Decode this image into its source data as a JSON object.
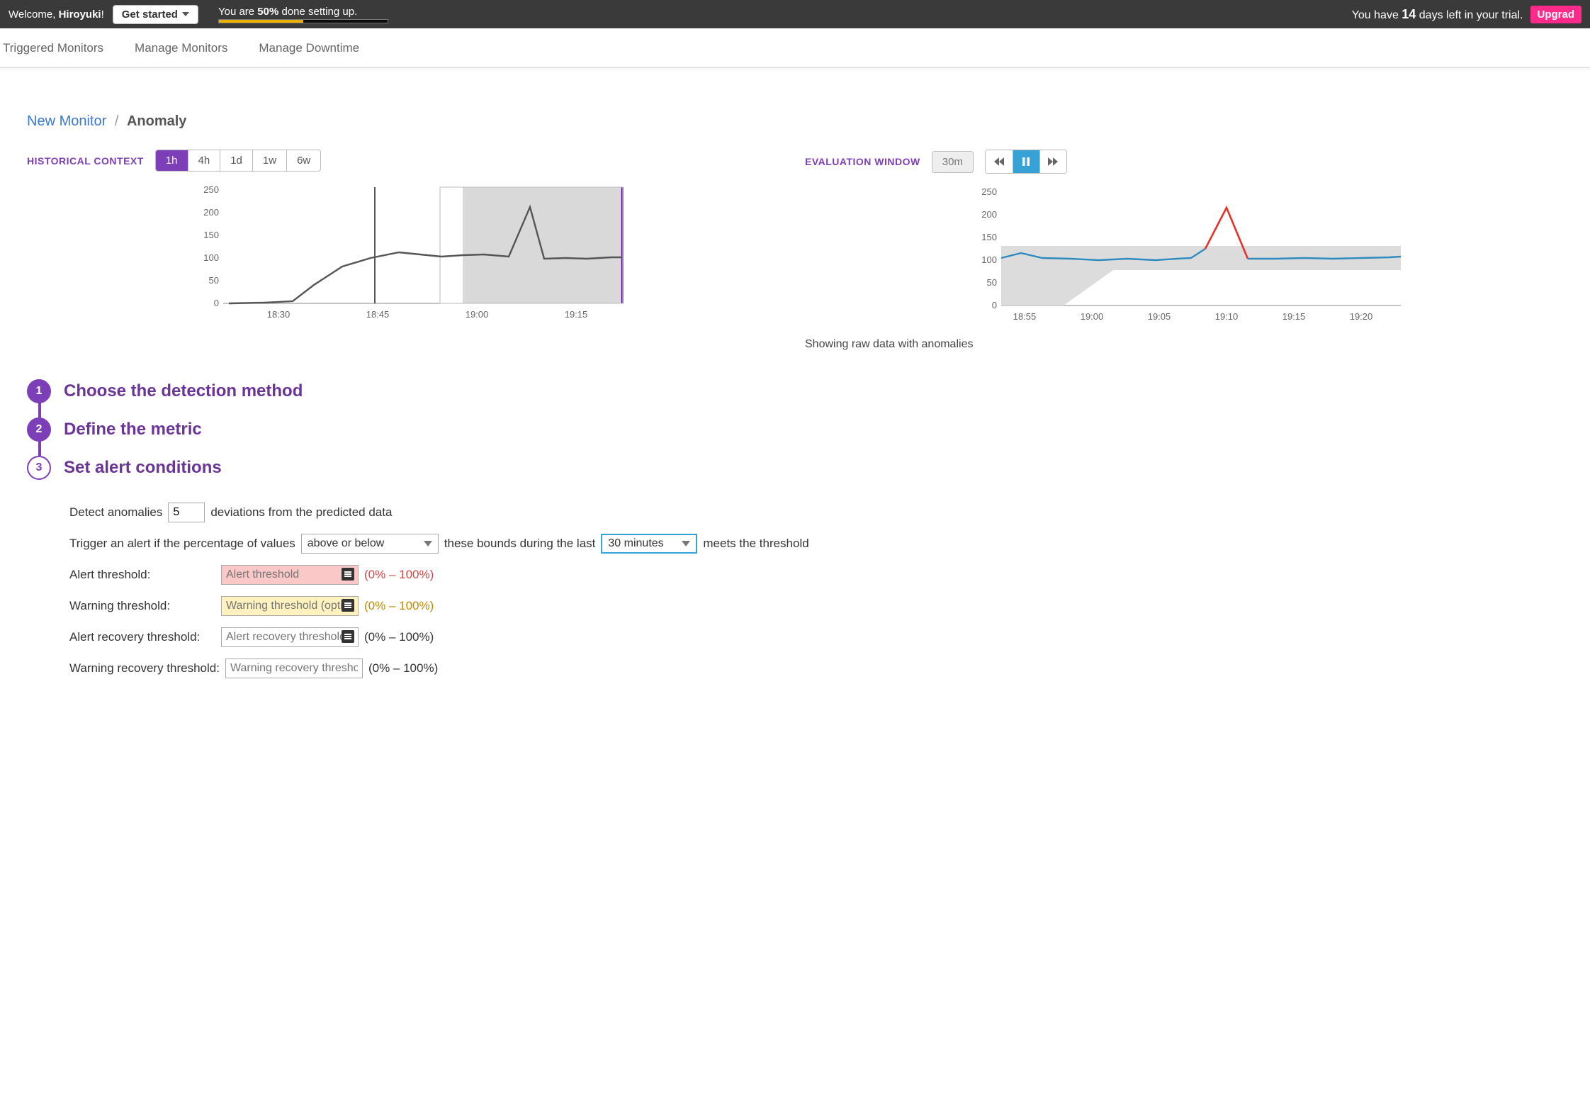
{
  "topbar": {
    "welcome_prefix": "Welcome, ",
    "welcome_name": "Hiroyuki",
    "welcome_suffix": "!",
    "get_started": "Get started",
    "setup_prefix": "You are ",
    "setup_percent": "50%",
    "setup_suffix": " done setting up.",
    "setup_progress_pct": 50,
    "trial_prefix": "You have ",
    "trial_days": "14",
    "trial_suffix": " days left in your trial.",
    "upgrade": "Upgrad"
  },
  "subnav": {
    "items": [
      "Triggered Monitors",
      "Manage Monitors",
      "Manage Downtime"
    ]
  },
  "breadcrumb": {
    "parent": "New Monitor",
    "current": "Anomaly"
  },
  "historical": {
    "title": "HISTORICAL CONTEXT",
    "ranges": [
      "1h",
      "4h",
      "1d",
      "1w",
      "6w"
    ],
    "active_range": "1h"
  },
  "evalwin": {
    "title": "EVALUATION WINDOW",
    "range": "30m",
    "active_button": "pause",
    "caption": "Showing raw data with anomalies"
  },
  "steps": {
    "s1": "Choose the detection method",
    "s2": "Define the metric",
    "s3": "Set alert conditions"
  },
  "form": {
    "detect_prefix": "Detect anomalies",
    "detect_value": "5",
    "detect_suffix": "deviations from the predicted data",
    "trigger_prefix": "Trigger an alert if the percentage of values",
    "direction": "above or below",
    "trigger_mid": "these bounds during the last",
    "window": "30 minutes",
    "trigger_suffix": "meets the threshold",
    "alert_th_label": "Alert threshold:",
    "alert_th_ph": "Alert threshold",
    "alert_th_range": "(0% – 100%)",
    "warn_th_label": "Warning threshold:",
    "warn_th_ph": "Warning threshold (optional)",
    "warn_th_range": "(0% – 100%)",
    "alert_rec_label": "Alert recovery threshold:",
    "alert_rec_ph": "Alert recovery threshold",
    "alert_rec_range": "(0% – 100%)",
    "warn_rec_label": "Warning recovery threshold:",
    "warn_rec_ph": "Warning recovery threshold",
    "warn_rec_range": "(0% – 100%)"
  },
  "chart_data": [
    {
      "id": "historical",
      "type": "line",
      "title": "HISTORICAL CONTEXT",
      "x": [
        "18:25",
        "18:30",
        "18:35",
        "18:40",
        "18:45",
        "18:50",
        "18:55",
        "19:00",
        "19:02",
        "19:04",
        "19:05",
        "19:06",
        "19:08",
        "19:10",
        "19:15",
        "19:20",
        "19:22"
      ],
      "x_ticks": [
        "18:30",
        "18:45",
        "19:00",
        "19:15"
      ],
      "y_ticks": [
        0,
        50,
        100,
        150,
        200,
        250
      ],
      "ylim": [
        0,
        260
      ],
      "series": [
        {
          "name": "metric",
          "color": "#555555",
          "values": [
            1,
            2,
            5,
            45,
            80,
            105,
            120,
            115,
            110,
            112,
            115,
            210,
            108,
            110,
            108,
            110,
            110
          ]
        }
      ],
      "shaded_region_x": [
        "18:58",
        "19:22"
      ],
      "marker_x": "18:46"
    },
    {
      "id": "evaluation",
      "type": "line",
      "title": "EVALUATION WINDOW",
      "x": [
        "18:52",
        "18:54",
        "18:56",
        "18:58",
        "19:00",
        "19:02",
        "19:04",
        "19:05",
        "19:06",
        "19:07",
        "19:08",
        "19:09",
        "19:10",
        "19:12",
        "19:15",
        "19:18",
        "19:20",
        "19:22"
      ],
      "x_ticks": [
        "18:55",
        "19:00",
        "19:05",
        "19:10",
        "19:15",
        "19:20"
      ],
      "y_ticks": [
        0,
        50,
        100,
        150,
        200,
        250
      ],
      "ylim": [
        0,
        260
      ],
      "series": [
        {
          "name": "metric",
          "color": "#2e8bc0",
          "values": [
            110,
            120,
            110,
            108,
            105,
            108,
            105,
            108,
            110,
            150,
            210,
            115,
            108,
            108,
            110,
            108,
            110,
            112
          ]
        }
      ],
      "anomaly_segment": {
        "color": "#e5332a",
        "x_start": "19:06",
        "x_end": "19:09"
      },
      "band": {
        "color": "#dcdcdc",
        "upper": 138,
        "lower_early": 0,
        "lower_late": 78,
        "taper_x": "19:00"
      }
    }
  ]
}
